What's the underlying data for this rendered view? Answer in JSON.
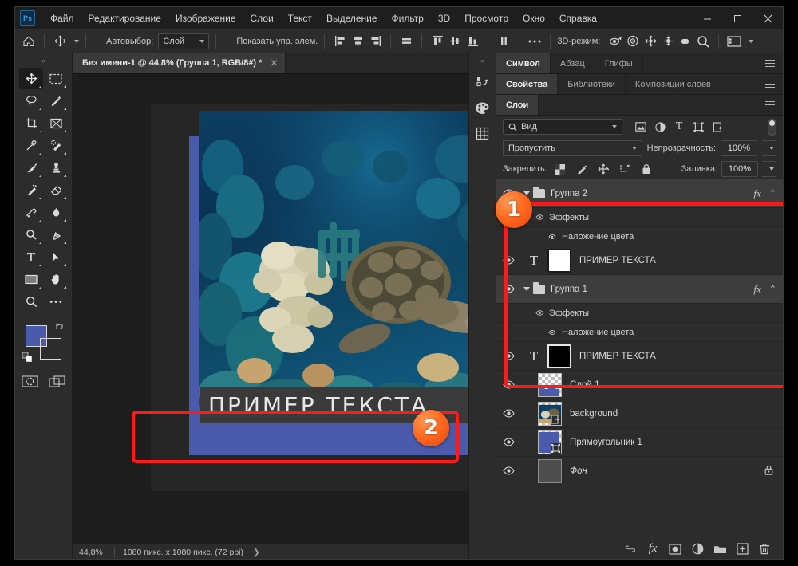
{
  "app": {
    "logo": "Ps"
  },
  "menubar": {
    "items": [
      "Файл",
      "Редактирование",
      "Изображение",
      "Слои",
      "Текст",
      "Выделение",
      "Фильтр",
      "3D",
      "Просмотр",
      "Окно",
      "Справка"
    ],
    "window_controls": {
      "minimize": "—",
      "maximize": "▢",
      "close": "✕"
    }
  },
  "optionsbar": {
    "home_icon": "home-icon",
    "move_tool_icon": "move-tool-icon",
    "autoselect_label": "Автовыбор:",
    "autoselect_value": "Слой",
    "show_controls_label": "Показать упр. элем.",
    "align_icons": [
      "align-left-icon",
      "align-center-h-icon",
      "align-right-icon",
      "distribute-h-icon",
      "align-top-icon",
      "align-center-v-icon",
      "align-bottom-icon",
      "distribute-v-icon"
    ],
    "more_icon": "more-options-icon",
    "mode_3d_label": "3D-режим:",
    "mode_3d_icons": [
      "rotate-3d-icon",
      "roll-3d-icon",
      "pan-3d-icon",
      "slide-3d-icon",
      "scale-3d-icon",
      "zoom-3d-icon"
    ],
    "workspace_icon": "workspace-icon"
  },
  "tools": {
    "items": [
      {
        "name": "move-tool",
        "glyph": "✥",
        "active": true
      },
      {
        "name": "rectangular-marquee-tool",
        "glyph": "▭",
        "active": false
      },
      {
        "name": "lasso-tool",
        "glyph": "◯",
        "active": false
      },
      {
        "name": "magic-wand-tool",
        "glyph": "✧",
        "active": false
      },
      {
        "name": "crop-tool",
        "glyph": "⌗",
        "active": false
      },
      {
        "name": "frame-tool",
        "glyph": "⊠",
        "active": false
      },
      {
        "name": "eyedropper-tool",
        "glyph": "⟋",
        "active": false
      },
      {
        "name": "spot-healing-brush-tool",
        "glyph": "✦",
        "active": false
      },
      {
        "name": "brush-tool",
        "glyph": "🖌",
        "active": false
      },
      {
        "name": "clone-stamp-tool",
        "glyph": "⚲",
        "active": false
      },
      {
        "name": "history-brush-tool",
        "glyph": "✎",
        "active": false
      },
      {
        "name": "eraser-tool",
        "glyph": "◺",
        "active": false
      },
      {
        "name": "gradient-tool",
        "glyph": "◩",
        "active": false
      },
      {
        "name": "blur-tool",
        "glyph": "◠",
        "active": false
      },
      {
        "name": "dodge-tool",
        "glyph": "◔",
        "active": false
      },
      {
        "name": "pen-tool",
        "glyph": "✒",
        "active": false
      },
      {
        "name": "type-tool",
        "glyph": "T",
        "active": false
      },
      {
        "name": "path-selection-tool",
        "glyph": "➤",
        "active": false
      },
      {
        "name": "rectangle-tool",
        "glyph": "▬",
        "active": false
      },
      {
        "name": "hand-tool",
        "glyph": "✋",
        "active": false
      },
      {
        "name": "zoom-tool",
        "glyph": "⚲",
        "active": false
      },
      {
        "name": "edit-toolbar-tool",
        "glyph": "•••",
        "active": false
      }
    ],
    "foreground_color": "#4a5bab",
    "background_color": "#ffffff",
    "quickmask_icon": "quick-mask-icon",
    "screenmode_icon": "screen-mode-icon"
  },
  "document": {
    "tab_title": "Без имени-1 @ 44,8% (Группа 1, RGB/8#) *",
    "tab_close": "✕",
    "canvas_text": "ПРИМЕР ТЕКСТА"
  },
  "statusbar": {
    "zoom": "44,8%",
    "dimensions": "1080 пикс. x 1080 пикс. (72 ppi)",
    "arrow": "❯"
  },
  "minidock": {
    "icons": [
      "history-panel-icon",
      "color-panel-icon",
      "pattern-panel-icon"
    ]
  },
  "panels": {
    "group_top": {
      "tabs": [
        "Символ",
        "Абзац",
        "Глифы"
      ],
      "active": 0
    },
    "group_mid": {
      "tabs": [
        "Свойства",
        "Библиотеки",
        "Композиции слоев"
      ],
      "active": 0
    },
    "group_layers": {
      "tabs": [
        "Слои"
      ],
      "active": 0
    }
  },
  "layers_panel": {
    "filter_placeholder": "Вид",
    "filter_icons": [
      "pixel-filter-icon",
      "adjustment-filter-icon",
      "type-filter-icon",
      "shape-filter-icon",
      "smartobject-filter-icon"
    ],
    "blend_mode": "Пропустить",
    "opacity_label": "Непрозрачность:",
    "opacity_value": "100%",
    "lock_label": "Закрепить:",
    "lock_icons": [
      "lock-transparent-icon",
      "lock-image-icon",
      "lock-position-icon",
      "lock-artboard-icon",
      "lock-all-icon"
    ],
    "fill_label": "Заливка:",
    "fill_value": "100%",
    "rows": [
      {
        "type": "group",
        "name": "Группа 2",
        "indent": 0,
        "fx": "fx",
        "thumb": "folder",
        "selected": false
      },
      {
        "type": "effects",
        "name": "Эффекты",
        "indent": 1
      },
      {
        "type": "effect",
        "name": "Наложение цвета",
        "indent": 2
      },
      {
        "type": "text",
        "name": "ПРИМЕР ТЕКСТА",
        "indent": 1,
        "thumb": "white",
        "selected": false
      },
      {
        "type": "group",
        "name": "Группа 1",
        "indent": 0,
        "fx": "fx",
        "thumb": "folder",
        "selected": true
      },
      {
        "type": "effects",
        "name": "Эффекты",
        "indent": 1
      },
      {
        "type": "effect",
        "name": "Наложение цвета",
        "indent": 2
      },
      {
        "type": "text",
        "name": "ПРИМЕР ТЕКСТА",
        "indent": 1,
        "thumb": "black",
        "selected": false
      },
      {
        "type": "layer",
        "name": "Слой 1",
        "indent": 0,
        "thumb": "checker-wave"
      },
      {
        "type": "layer",
        "name": "background",
        "indent": 0,
        "thumb": "photo"
      },
      {
        "type": "layer",
        "name": "Прямоугольник 1",
        "indent": 0,
        "thumb": "blue"
      },
      {
        "type": "layer",
        "name": "Фон",
        "indent": 0,
        "thumb": "gray",
        "locked": true,
        "italic": true
      }
    ],
    "footer_icons": [
      "link-layers-icon",
      "add-layer-style-icon",
      "add-layer-mask-icon",
      "new-adjustment-layer-icon",
      "new-group-icon",
      "new-layer-icon",
      "delete-layer-icon"
    ]
  },
  "annotations": {
    "badge1": "1",
    "badge2": "2",
    "highlight_color": "#ff1a1a"
  }
}
